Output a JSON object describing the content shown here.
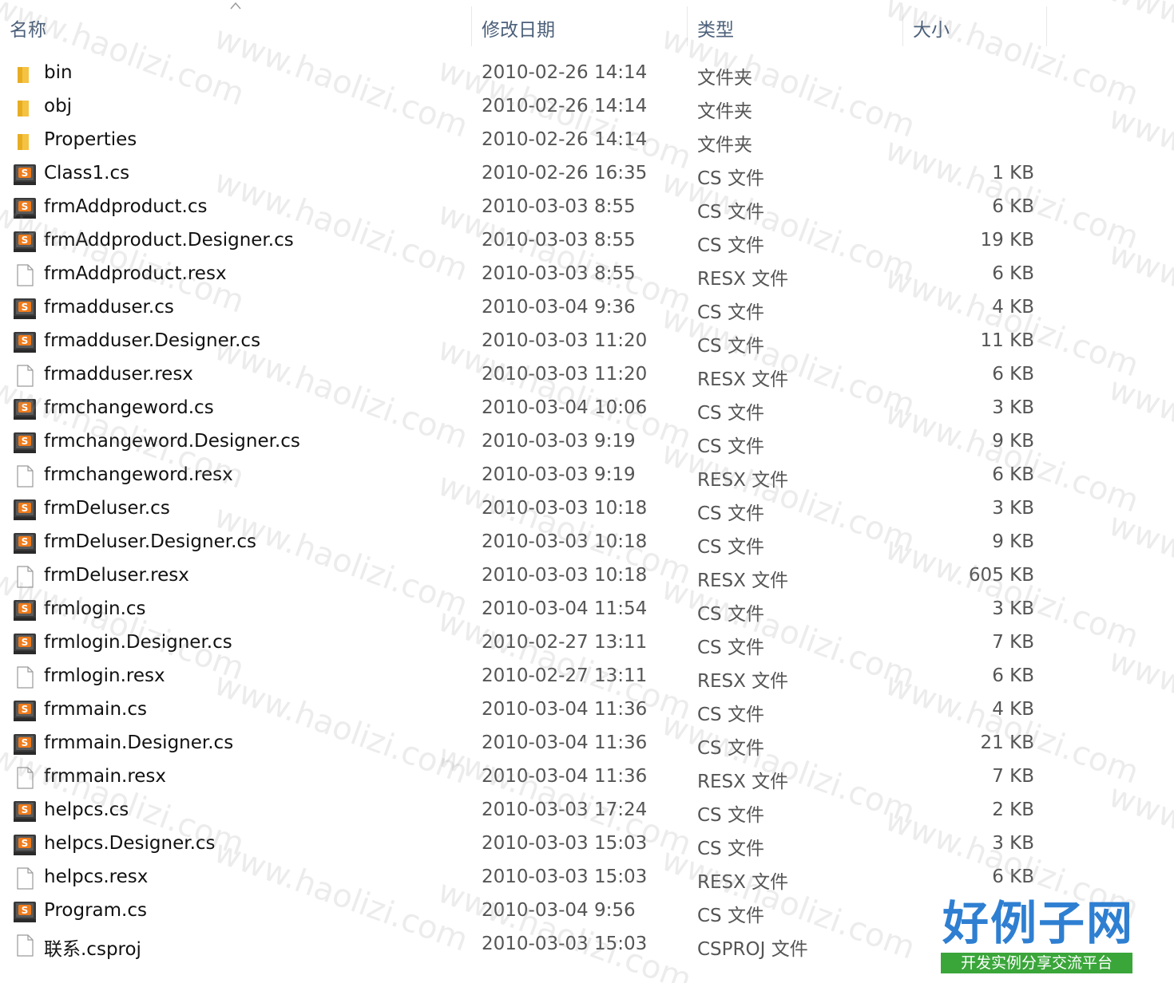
{
  "columns": {
    "name": "名称",
    "date": "修改日期",
    "type": "类型",
    "size": "大小"
  },
  "rows": [
    {
      "name": "bin",
      "date": "2010-02-26 14:14",
      "type": "文件夹",
      "size": "",
      "icon": "folder-icon"
    },
    {
      "name": "obj",
      "date": "2010-02-26 14:14",
      "type": "文件夹",
      "size": "",
      "icon": "folder-icon"
    },
    {
      "name": "Properties",
      "date": "2010-02-26 14:14",
      "type": "文件夹",
      "size": "",
      "icon": "folder-icon"
    },
    {
      "name": "Class1.cs",
      "date": "2010-02-26 16:35",
      "type": "CS 文件",
      "size": "1 KB",
      "icon": "cs-file-icon"
    },
    {
      "name": "frmAddproduct.cs",
      "date": "2010-03-03 8:55",
      "type": "CS 文件",
      "size": "6 KB",
      "icon": "cs-file-icon"
    },
    {
      "name": "frmAddproduct.Designer.cs",
      "date": "2010-03-03 8:55",
      "type": "CS 文件",
      "size": "19 KB",
      "icon": "cs-file-icon"
    },
    {
      "name": "frmAddproduct.resx",
      "date": "2010-03-03 8:55",
      "type": "RESX 文件",
      "size": "6 KB",
      "icon": "blank-file-icon"
    },
    {
      "name": "frmadduser.cs",
      "date": "2010-03-04 9:36",
      "type": "CS 文件",
      "size": "4 KB",
      "icon": "cs-file-icon"
    },
    {
      "name": "frmadduser.Designer.cs",
      "date": "2010-03-03 11:20",
      "type": "CS 文件",
      "size": "11 KB",
      "icon": "cs-file-icon"
    },
    {
      "name": "frmadduser.resx",
      "date": "2010-03-03 11:20",
      "type": "RESX 文件",
      "size": "6 KB",
      "icon": "blank-file-icon"
    },
    {
      "name": "frmchangeword.cs",
      "date": "2010-03-04 10:06",
      "type": "CS 文件",
      "size": "3 KB",
      "icon": "cs-file-icon"
    },
    {
      "name": "frmchangeword.Designer.cs",
      "date": "2010-03-03 9:19",
      "type": "CS 文件",
      "size": "9 KB",
      "icon": "cs-file-icon"
    },
    {
      "name": "frmchangeword.resx",
      "date": "2010-03-03 9:19",
      "type": "RESX 文件",
      "size": "6 KB",
      "icon": "blank-file-icon"
    },
    {
      "name": "frmDeluser.cs",
      "date": "2010-03-03 10:18",
      "type": "CS 文件",
      "size": "3 KB",
      "icon": "cs-file-icon"
    },
    {
      "name": "frmDeluser.Designer.cs",
      "date": "2010-03-03 10:18",
      "type": "CS 文件",
      "size": "9 KB",
      "icon": "cs-file-icon"
    },
    {
      "name": "frmDeluser.resx",
      "date": "2010-03-03 10:18",
      "type": "RESX 文件",
      "size": "605 KB",
      "icon": "blank-file-icon"
    },
    {
      "name": "frmlogin.cs",
      "date": "2010-03-04 11:54",
      "type": "CS 文件",
      "size": "3 KB",
      "icon": "cs-file-icon"
    },
    {
      "name": "frmlogin.Designer.cs",
      "date": "2010-02-27 13:11",
      "type": "CS 文件",
      "size": "7 KB",
      "icon": "cs-file-icon"
    },
    {
      "name": "frmlogin.resx",
      "date": "2010-02-27 13:11",
      "type": "RESX 文件",
      "size": "6 KB",
      "icon": "blank-file-icon"
    },
    {
      "name": "frmmain.cs",
      "date": "2010-03-04 11:36",
      "type": "CS 文件",
      "size": "4 KB",
      "icon": "cs-file-icon"
    },
    {
      "name": "frmmain.Designer.cs",
      "date": "2010-03-04 11:36",
      "type": "CS 文件",
      "size": "21 KB",
      "icon": "cs-file-icon"
    },
    {
      "name": "frmmain.resx",
      "date": "2010-03-04 11:36",
      "type": "RESX 文件",
      "size": "7 KB",
      "icon": "blank-file-icon"
    },
    {
      "name": "helpcs.cs",
      "date": "2010-03-03 17:24",
      "type": "CS 文件",
      "size": "2 KB",
      "icon": "cs-file-icon"
    },
    {
      "name": "helpcs.Designer.cs",
      "date": "2010-03-03 15:03",
      "type": "CS 文件",
      "size": "3 KB",
      "icon": "cs-file-icon"
    },
    {
      "name": "helpcs.resx",
      "date": "2010-03-03 15:03",
      "type": "RESX 文件",
      "size": "6 KB",
      "icon": "blank-file-icon"
    },
    {
      "name": "Program.cs",
      "date": "2010-03-04 9:56",
      "type": "CS 文件",
      "size": "",
      "icon": "cs-file-icon"
    },
    {
      "name": "联系.csproj",
      "date": "2010-03-03 15:03",
      "type": "CSPROJ 文件",
      "size": "",
      "icon": "blank-file-icon"
    }
  ],
  "watermark": "www.haolizi.com",
  "logo": {
    "main": "好例子网",
    "sub": "开发实例分享交流平台"
  },
  "colors": {
    "header_text": "#4c607a",
    "folder": "#f5c242",
    "cs_icon_bg": "#3a3a3a",
    "cs_icon_accent": "#f07b1a",
    "logo_blue": "#2e7fd1",
    "logo_green": "#3aa63a"
  }
}
